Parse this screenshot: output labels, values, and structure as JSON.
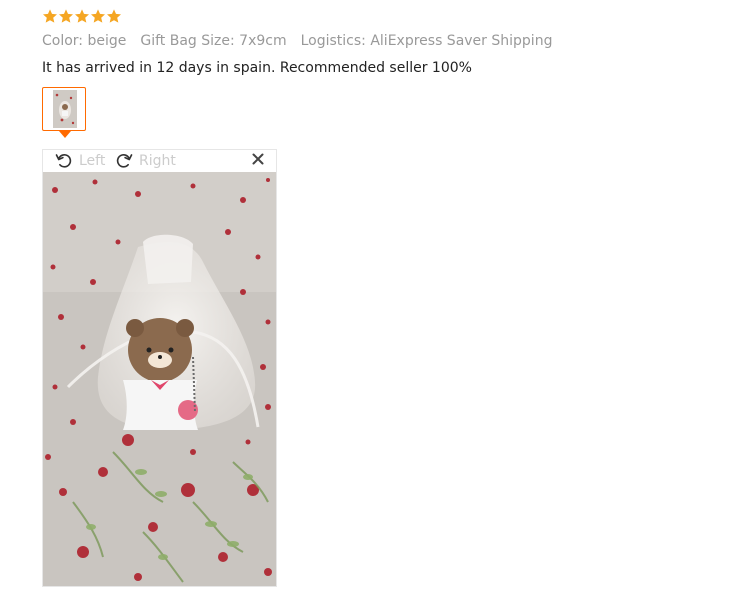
{
  "review": {
    "rating": 5,
    "rating_max": 5,
    "star_color": "#f5a623",
    "meta": {
      "color": "Color: beige",
      "size": "Gift Bag Size: 7x9cm",
      "logistics": "Logistics: AliExpress Saver Shipping"
    },
    "comment": "It has arrived in 12 days in spain. Recommended seller 100%"
  },
  "thumbnails": {
    "selected_border_color": "#ff6a00",
    "items": [
      {
        "icon": "photo-thumbnail"
      }
    ]
  },
  "viewer": {
    "rotate_left_label": "Left",
    "rotate_right_label": "Right",
    "rotate_left_icon": "rotate-left-icon",
    "rotate_right_icon": "rotate-right-icon",
    "close_icon": "close-icon"
  }
}
